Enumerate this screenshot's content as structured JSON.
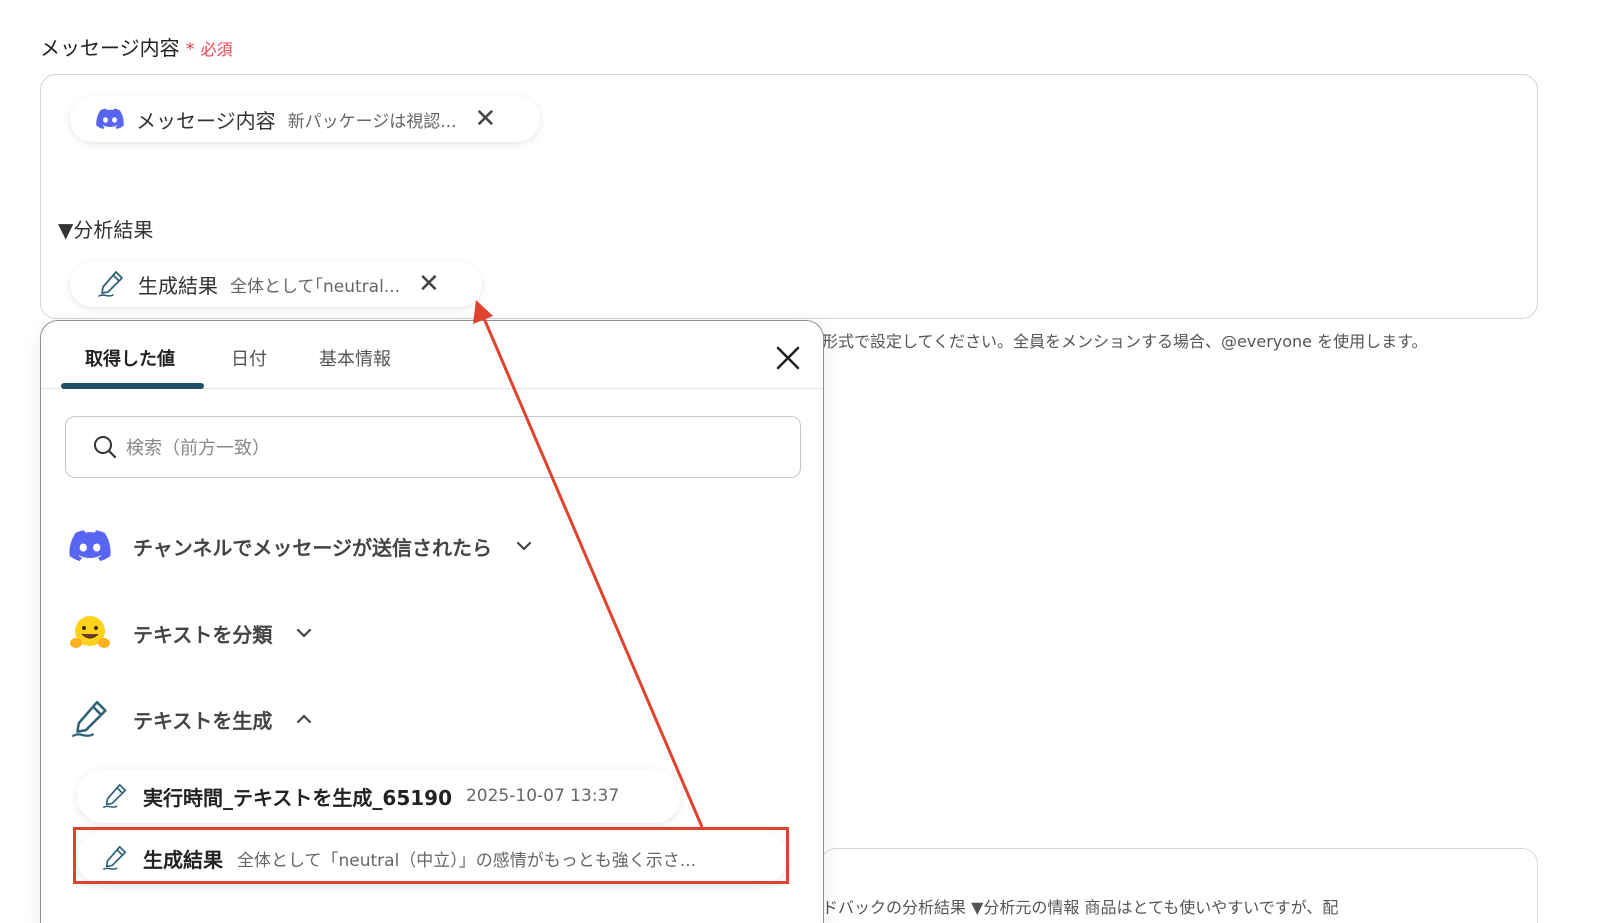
{
  "field": {
    "label": "メッセージ内容",
    "required_star": "*",
    "required_text": "必須"
  },
  "editor": {
    "chip1": {
      "name": "メッセージ内容",
      "value": "新パッケージは視認..."
    },
    "section_text": "▼分析結果",
    "chip2": {
      "name": "生成結果",
      "value": "全体として｢neutral..."
    }
  },
  "hint": "形式で設定してください。全員をメンションする場合、@everyone を使用します。",
  "bottom_partial_text": "ドバックの分析結果 ▼分析元の情報 商品はとても使いやすいですが、配",
  "popup": {
    "tabs": [
      {
        "label": "取得した値"
      },
      {
        "label": "日付"
      },
      {
        "label": "基本情報"
      }
    ],
    "search_placeholder": "検索（前方一致）",
    "groups": [
      {
        "label": "チャンネルでメッセージが送信されたら",
        "icon": "discord-icon"
      },
      {
        "label": "テキストを分類",
        "icon": "hugging-face-icon"
      },
      {
        "label": "テキストを生成",
        "icon": "pencil-icon"
      }
    ],
    "items": [
      {
        "name": "実行時間_テキストを生成_65190",
        "value": "2025-10-07 13:37"
      },
      {
        "name": "生成結果",
        "value": "全体として「neutral（中立）」の感情がもっとも強く示さ..."
      }
    ]
  },
  "colors": {
    "accent": "#1e4f6b",
    "required": "#e5484d",
    "annotation": "#e0432d",
    "discord": "#5865f2"
  }
}
